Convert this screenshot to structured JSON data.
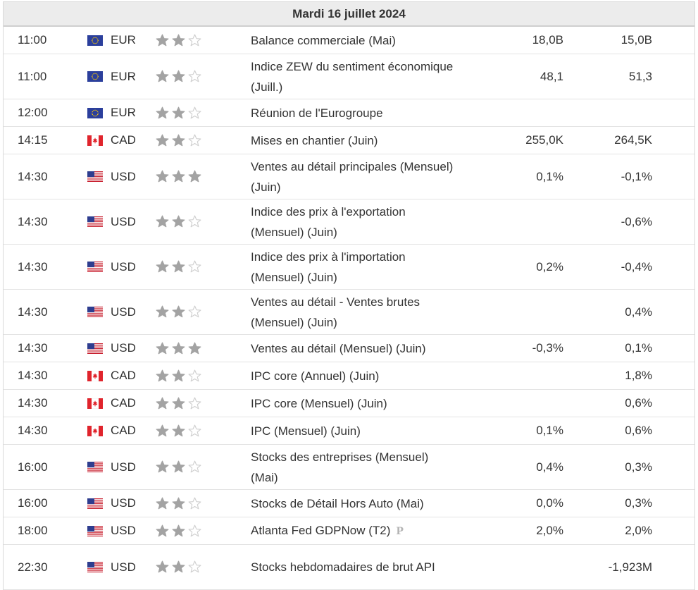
{
  "calendar": {
    "date": "Mardi 16 juillet 2024",
    "colors": {
      "star_filled": "#a3a3a3",
      "star_empty": "#cfcfcf",
      "prelim_mark": "#b5b5b5"
    },
    "events": [
      {
        "time": "11:00",
        "currency": "EUR",
        "flag": "eu-flag-icon",
        "impact": 2,
        "event": "Balance commerciale (Mai)",
        "actual": "18,0B",
        "forecast": "15,0B"
      },
      {
        "time": "11:00",
        "currency": "EUR",
        "flag": "eu-flag-icon",
        "impact": 2,
        "event": "Indice ZEW du sentiment économique (Juill.)",
        "actual": "48,1",
        "forecast": "51,3"
      },
      {
        "time": "12:00",
        "currency": "EUR",
        "flag": "eu-flag-icon",
        "impact": 2,
        "event": "Réunion de l'Eurogroupe",
        "actual": "",
        "forecast": ""
      },
      {
        "time": "14:15",
        "currency": "CAD",
        "flag": "canada-flag-icon",
        "impact": 2,
        "event": "Mises en chantier (Juin)",
        "actual": "255,0K",
        "forecast": "264,5K"
      },
      {
        "time": "14:30",
        "currency": "USD",
        "flag": "us-flag-icon",
        "impact": 3,
        "event": "Ventes au détail principales (Mensuel) (Juin)",
        "actual": "0,1%",
        "forecast": "-0,1%"
      },
      {
        "time": "14:30",
        "currency": "USD",
        "flag": "us-flag-icon",
        "impact": 2,
        "event": "Indice des prix à l'exportation (Mensuel) (Juin)",
        "actual": "",
        "forecast": "-0,6%"
      },
      {
        "time": "14:30",
        "currency": "USD",
        "flag": "us-flag-icon",
        "impact": 2,
        "event": "Indice des prix à l'importation (Mensuel) (Juin)",
        "actual": "0,2%",
        "forecast": "-0,4%"
      },
      {
        "time": "14:30",
        "currency": "USD",
        "flag": "us-flag-icon",
        "impact": 2,
        "event": "Ventes au détail - Ventes brutes (Mensuel) (Juin)",
        "actual": "",
        "forecast": "0,4%"
      },
      {
        "time": "14:30",
        "currency": "USD",
        "flag": "us-flag-icon",
        "impact": 3,
        "event": "Ventes au détail (Mensuel) (Juin)",
        "actual": "-0,3%",
        "forecast": "0,1%"
      },
      {
        "time": "14:30",
        "currency": "CAD",
        "flag": "canada-flag-icon",
        "impact": 2,
        "event": "IPC core (Annuel) (Juin)",
        "actual": "",
        "forecast": "1,8%"
      },
      {
        "time": "14:30",
        "currency": "CAD",
        "flag": "canada-flag-icon",
        "impact": 2,
        "event": "IPC core (Mensuel) (Juin)",
        "actual": "",
        "forecast": "0,6%"
      },
      {
        "time": "14:30",
        "currency": "CAD",
        "flag": "canada-flag-icon",
        "impact": 2,
        "event": "IPC (Mensuel) (Juin)",
        "actual": "0,1%",
        "forecast": "0,6%"
      },
      {
        "time": "16:00",
        "currency": "USD",
        "flag": "us-flag-icon",
        "impact": 2,
        "event": "Stocks des entreprises (Mensuel) (Mai)",
        "actual": "0,4%",
        "forecast": "0,3%"
      },
      {
        "time": "16:00",
        "currency": "USD",
        "flag": "us-flag-icon",
        "impact": 2,
        "event": "Stocks de Détail Hors Auto (Mai)",
        "actual": "0,0%",
        "forecast": "0,3%"
      },
      {
        "time": "18:00",
        "currency": "USD",
        "flag": "us-flag-icon",
        "impact": 2,
        "event": "Atlanta Fed GDPNow (T2)",
        "prelim": "P",
        "actual": "2,0%",
        "forecast": "2,0%"
      },
      {
        "time": "22:30",
        "currency": "USD",
        "flag": "us-flag-icon",
        "impact": 2,
        "event": "Stocks hebdomadaires de brut API",
        "actual": "",
        "forecast": "-1,923M"
      }
    ]
  }
}
